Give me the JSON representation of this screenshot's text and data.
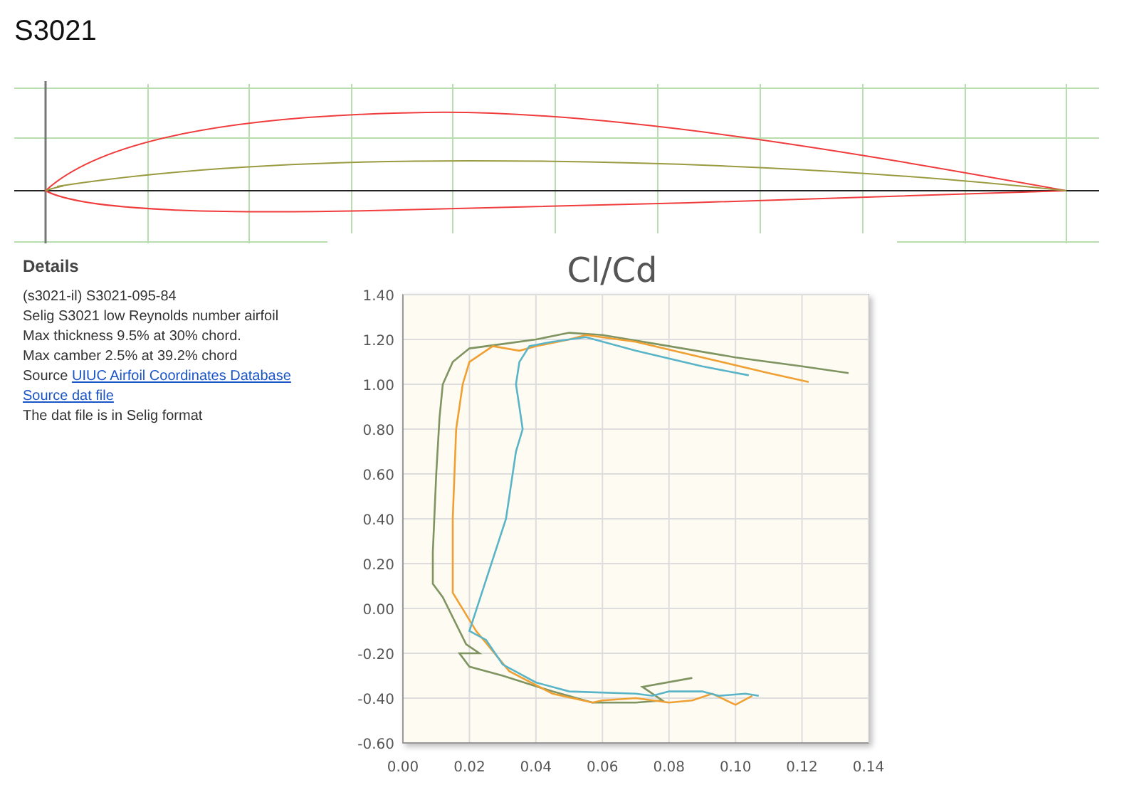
{
  "title": "S3021",
  "details": {
    "heading": "Details",
    "items": [
      {
        "kind": "text",
        "text": "(s3021-il) S3021-095-84"
      },
      {
        "kind": "text",
        "text": "Selig S3021 low Reynolds number airfoil"
      },
      {
        "kind": "text",
        "text": "Max thickness 9.5% at 30% chord."
      },
      {
        "kind": "text",
        "text": "Max camber 2.5% at 39.2% chord"
      },
      {
        "kind": "source",
        "text": "Source",
        "link": "UIUC Airfoil Coordinates Database"
      },
      {
        "kind": "link",
        "text": "Source dat file"
      },
      {
        "kind": "text",
        "text": "The dat file is in Selig format"
      }
    ]
  },
  "chart": {
    "chart_data": {
      "type": "line",
      "title": "Cl/Cd",
      "grid": true,
      "xlim": [
        0,
        0.14
      ],
      "ylim": [
        -0.6,
        1.4
      ],
      "xticks": [
        {
          "value": 0,
          "label": "0.00"
        },
        {
          "value": 0.02,
          "label": "0.02"
        },
        {
          "value": 0.04,
          "label": "0.04"
        },
        {
          "value": 0.06,
          "label": "0.06"
        },
        {
          "value": 0.08,
          "label": "0.08"
        },
        {
          "value": 0.1,
          "label": "0.10"
        },
        {
          "value": 0.12,
          "label": "0.12"
        },
        {
          "value": 0.14,
          "label": "0.14"
        }
      ],
      "yticks": [
        {
          "value": -0.6,
          "label": "-0.60"
        },
        {
          "value": -0.4,
          "label": "-0.40"
        },
        {
          "value": -0.2,
          "label": "-0.20"
        },
        {
          "value": 0,
          "label": "0.00"
        },
        {
          "value": 0.2,
          "label": "0.20"
        },
        {
          "value": 0.4,
          "label": "0.40"
        },
        {
          "value": 0.6,
          "label": "0.60"
        },
        {
          "value": 0.8,
          "label": "0.80"
        },
        {
          "value": 1,
          "label": "1.00"
        },
        {
          "value": 1.2,
          "label": "1.20"
        },
        {
          "value": 1.4,
          "label": "1.40"
        }
      ],
      "series": [
        {
          "color": "#7f9460",
          "x": [
            0.087,
            0.072,
            0.078,
            0.07,
            0.057,
            0.045,
            0.03,
            0.02,
            0.017,
            0.023,
            0.019,
            0.012,
            0.009,
            0.009,
            0.01,
            0.011,
            0.012,
            0.015,
            0.02,
            0.03,
            0.04,
            0.05,
            0.06,
            0.08,
            0.1,
            0.12,
            0.134
          ],
          "values": [
            -0.31,
            -0.35,
            -0.41,
            -0.42,
            -0.42,
            -0.37,
            -0.3,
            -0.26,
            -0.2,
            -0.2,
            -0.16,
            0.05,
            0.11,
            0.25,
            0.6,
            0.85,
            1.0,
            1.1,
            1.16,
            1.18,
            1.2,
            1.23,
            1.22,
            1.17,
            1.12,
            1.08,
            1.05
          ]
        },
        {
          "color": "#f0a032",
          "x": [
            0.105,
            0.1,
            0.093,
            0.087,
            0.08,
            0.07,
            0.06,
            0.057,
            0.045,
            0.032,
            0.022,
            0.015,
            0.015,
            0.016,
            0.018,
            0.02,
            0.027,
            0.035,
            0.04,
            0.05,
            0.055,
            0.07,
            0.09,
            0.11,
            0.122
          ],
          "values": [
            -0.39,
            -0.43,
            -0.38,
            -0.41,
            -0.42,
            -0.4,
            -0.41,
            -0.42,
            -0.38,
            -0.28,
            -0.1,
            0.07,
            0.4,
            0.8,
            1.0,
            1.1,
            1.17,
            1.15,
            1.17,
            1.2,
            1.22,
            1.19,
            1.12,
            1.05,
            1.01
          ]
        },
        {
          "color": "#5ab4c8",
          "x": [
            0.107,
            0.103,
            0.095,
            0.09,
            0.08,
            0.075,
            0.07,
            0.05,
            0.04,
            0.03,
            0.025,
            0.02,
            0.031,
            0.034,
            0.036,
            0.035,
            0.034,
            0.035,
            0.038,
            0.045,
            0.055,
            0.07,
            0.09,
            0.104
          ],
          "values": [
            -0.39,
            -0.38,
            -0.39,
            -0.37,
            -0.37,
            -0.39,
            -0.38,
            -0.37,
            -0.33,
            -0.25,
            -0.14,
            -0.1,
            0.4,
            0.7,
            0.8,
            0.9,
            1.0,
            1.1,
            1.17,
            1.19,
            1.21,
            1.15,
            1.08,
            1.04
          ]
        }
      ]
    }
  }
}
